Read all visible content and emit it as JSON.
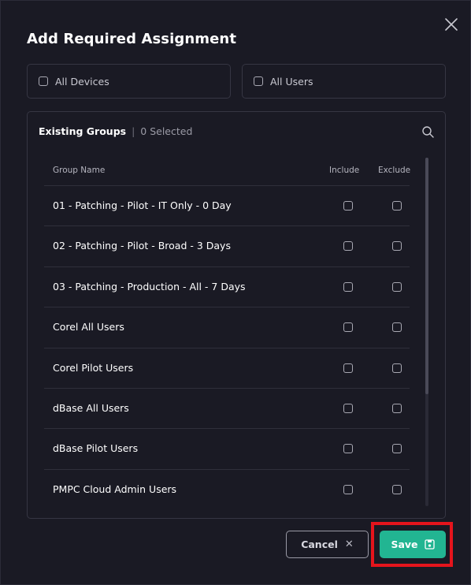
{
  "dialog": {
    "title": "Add Required Assignment",
    "close_icon": "close-icon"
  },
  "targets": {
    "all_devices": {
      "label": "All Devices",
      "checked": false
    },
    "all_users": {
      "label": "All Users",
      "checked": false
    }
  },
  "groups": {
    "title": "Existing Groups",
    "separator": "|",
    "selected_count": "0 Selected",
    "search_icon": "search-icon",
    "columns": {
      "name": "Group Name",
      "include": "Include",
      "exclude": "Exclude"
    },
    "rows": [
      {
        "name": "01 - Patching - Pilot - IT Only - 0 Day",
        "include": false,
        "exclude": false
      },
      {
        "name": "02 - Patching - Pilot - Broad - 3 Days",
        "include": false,
        "exclude": false
      },
      {
        "name": "03 - Patching - Production - All - 7 Days",
        "include": false,
        "exclude": false
      },
      {
        "name": "Corel All Users",
        "include": false,
        "exclude": false
      },
      {
        "name": "Corel Pilot Users",
        "include": false,
        "exclude": false
      },
      {
        "name": "dBase All Users",
        "include": false,
        "exclude": false
      },
      {
        "name": "dBase Pilot Users",
        "include": false,
        "exclude": false
      },
      {
        "name": "PMPC Cloud Admin Users",
        "include": false,
        "exclude": false
      }
    ]
  },
  "footer": {
    "cancel_label": "Cancel",
    "cancel_icon": "close-icon",
    "save_label": "Save",
    "save_icon": "save-icon"
  },
  "colors": {
    "background": "#1a1a24",
    "border": "#363643",
    "accent": "#22b592",
    "highlight": "#e5141c"
  }
}
